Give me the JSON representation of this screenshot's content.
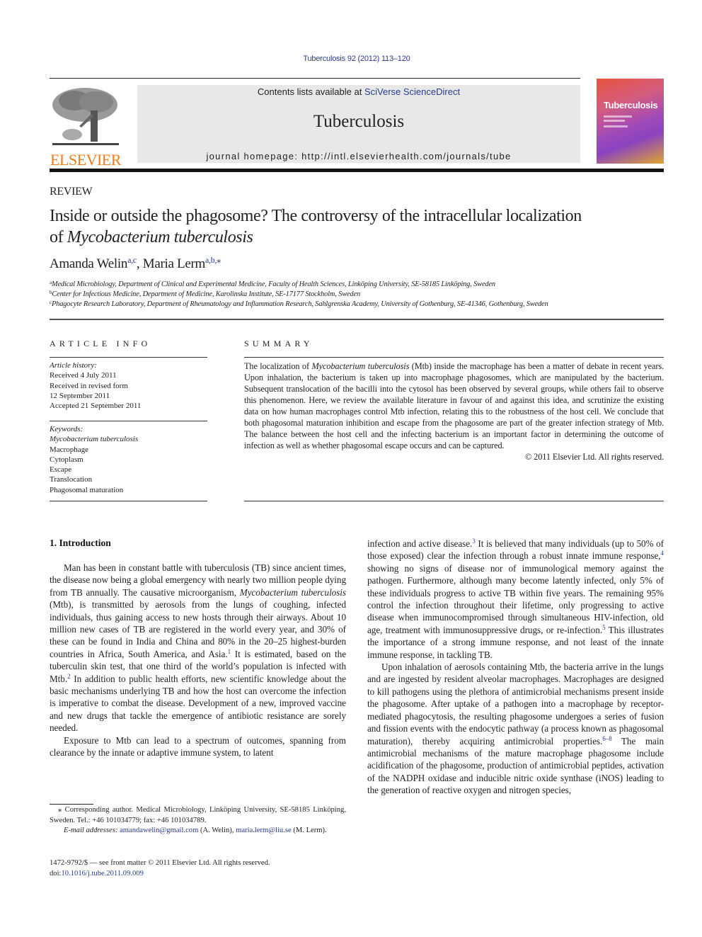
{
  "header": {
    "citation": "Tuberculosis 92 (2012) 113–120",
    "contents_prefix": "Contents lists available at ",
    "contents_link": "SciVerse ScienceDirect",
    "journal_name": "Tuberculosis",
    "homepage": "journal homepage: http://intl.elsevierhealth.com/journals/tube",
    "publisher_logo_text": "ELSEVIER",
    "cover_title": "Tuberculosis"
  },
  "colors": {
    "link": "#2a3c8c",
    "elsevier_orange": "#f07d1a",
    "banner_gray": "#e8e8e8"
  },
  "article": {
    "type": "REVIEW",
    "title_line1": "Inside or outside the phagosome? The controversy of the intracellular localization",
    "title_line2_prefix": "of ",
    "title_line2_italic": "Mycobacterium tuberculosis",
    "authors": [
      {
        "name": "Amanda Welin",
        "affil": "a,c"
      },
      {
        "name": "Maria Lerm",
        "affil": "a,b,⁎"
      }
    ],
    "affiliations": [
      {
        "key": "a",
        "text": "Medical Microbiology, Department of Clinical and Experimental Medicine, Faculty of Health Sciences, Linköping University, SE-58185 Linköping, Sweden"
      },
      {
        "key": "b",
        "text": "Center for Infectious Medicine, Department of Medicine, Karolinska Institute, SE-17177 Stockholm, Sweden"
      },
      {
        "key": "c",
        "text": "Phagocyte Research Laboratory, Department of Rheumatology and Inflammation Research, Sahlgrenska Academy, University of Gothenburg, SE-41346, Gothenburg, Sweden"
      }
    ]
  },
  "article_info": {
    "heading": "ARTICLE INFO",
    "history_label": "Article history:",
    "history": [
      "Received 4 July 2011",
      "Received in revised form",
      "12 September 2011",
      "Accepted 21 September 2011"
    ],
    "keywords_label": "Keywords:",
    "keyword_italic": "Mycobacterium tuberculosis",
    "keywords": [
      "Macrophage",
      "Cytoplasm",
      "Escape",
      "Translocation",
      "Phagosomal maturation"
    ]
  },
  "summary": {
    "heading": "SUMMARY",
    "p1": "The localization of ",
    "p1_italic": "Mycobacterium tuberculosis",
    "p2": " (Mtb) inside the macrophage has been a matter of debate in recent years. Upon inhalation, the bacterium is taken up into macrophage phagosomes, which are manipulated by the bacterium. Subsequent translocation of the bacilli into the cytosol has been observed by several groups, while others fail to observe this phenomenon. Here, we review the available literature in favour of and against this idea, and scrutinize the existing data on how human macrophages control Mtb infection, relating this to the robustness of the host cell. We conclude that both phagosomal maturation inhibition and escape from the phagosome are part of the greater infection strategy of Mtb. The balance between the host cell and the infecting bacterium is an important factor in determining the outcome of infection as well as whether phagosomal escape occurs and can be captured.",
    "copyright": "© 2011 Elsevier Ltd. All rights reserved."
  },
  "body": {
    "intro_heading": "1.  Introduction",
    "left": {
      "p1_a": "Man has been in constant battle with tuberculosis (TB) since ancient times, the disease now being a global emergency with nearly two million people dying from TB annually. The causative microorganism, ",
      "p1_italic": "Mycobacterium tuberculosis",
      "p1_b": " (Mtb), is transmitted by aerosols from the lungs of coughing, infected individuals, thus gaining access to new hosts through their airways. About 10 million new cases of TB are registered in the world every year, and 30% of these can be found in India and China and 80% in the 20–25 highest-burden countries in Africa, South America, and Asia.",
      "ref1": "1",
      "p1_c": " It is estimated, based on the tuberculin skin test, that one third of the world’s population is infected with Mtb.",
      "ref2": "2",
      "p1_d": " In addition to public health efforts, new scientific knowledge about the basic mecha­nisms underlying TB and how the host can overcome the infection is imperative to combat the disease. Development of a new, improved vaccine and new drugs that tackle the emergence of antibiotic resistance are sorely needed.",
      "p2": "Exposure to Mtb can lead to a spectrum of outcomes, spanning from clearance by the innate or adaptive immune system, to latent"
    },
    "right": {
      "p1_a": "infection and active disease.",
      "ref3": "3",
      "p1_b": " It is believed that many individuals (up to 50% of those exposed) clear the infection through a robust innate immune response,",
      "ref4": "4",
      "p1_c": " showing no signs of disease nor of immunological memory against the pathogen. Furthermore, although many become latently infected, only 5% of these indi­viduals progress to active TB within five years. The remaining 95% control the infection throughout their lifetime, only progressing to active disease when immunocompromised through simultaneous HIV-infection, old age, treatment with immunosuppressive drugs, or re-infection.",
      "ref5": "5",
      "p1_d": " This illustrates the importance of a strong immune response, and not least of the innate immune response, in tackling TB.",
      "p2_a": "Upon inhalation of aerosols containing Mtb, the bacteria arrive in the lungs and are ingested by resident alveolar macrophages. Macrophages are designed to kill pathogens using the plethora of antimicrobial mechanisms present inside the phagosome. After uptake of a pathogen into a macrophage by receptor-mediated phagocytosis, the resulting phagosome undergoes a series of fusion and fission events with the endocytic pathway (a process known as phagosomal maturation), thereby acquiring antimicro­bial properties.",
      "ref6_8": "6–8",
      "p2_b": " The main antimicrobial mechanisms of the mature macrophage phagosome include acidification of the phag­osome, production of antimicrobial peptides, activation of the NADPH oxidase and inducible nitric oxide synthase (iNOS) leading to the generation of reactive oxygen and nitrogen species,"
    }
  },
  "footnote": {
    "corresponding": "⁎ Corresponding author. Medical Microbiology, Linköping University, SE-58185 Linköping, Sweden. Tel.: +46 101034779; fax: +46 101034789.",
    "email_label": "E-mail addresses:",
    "email1": "amandawelin@gmail.com",
    "email1_owner": " (A. Welin), ",
    "email2": "maria.lerm@liu.se",
    "email2_owner": " (M. Lerm).",
    "issn": "1472-9792/$ — see front matter © 2011 Elsevier Ltd. All rights reserved.",
    "doi_prefix": "doi:",
    "doi": "10.1016/j.tube.2011.09.009"
  }
}
